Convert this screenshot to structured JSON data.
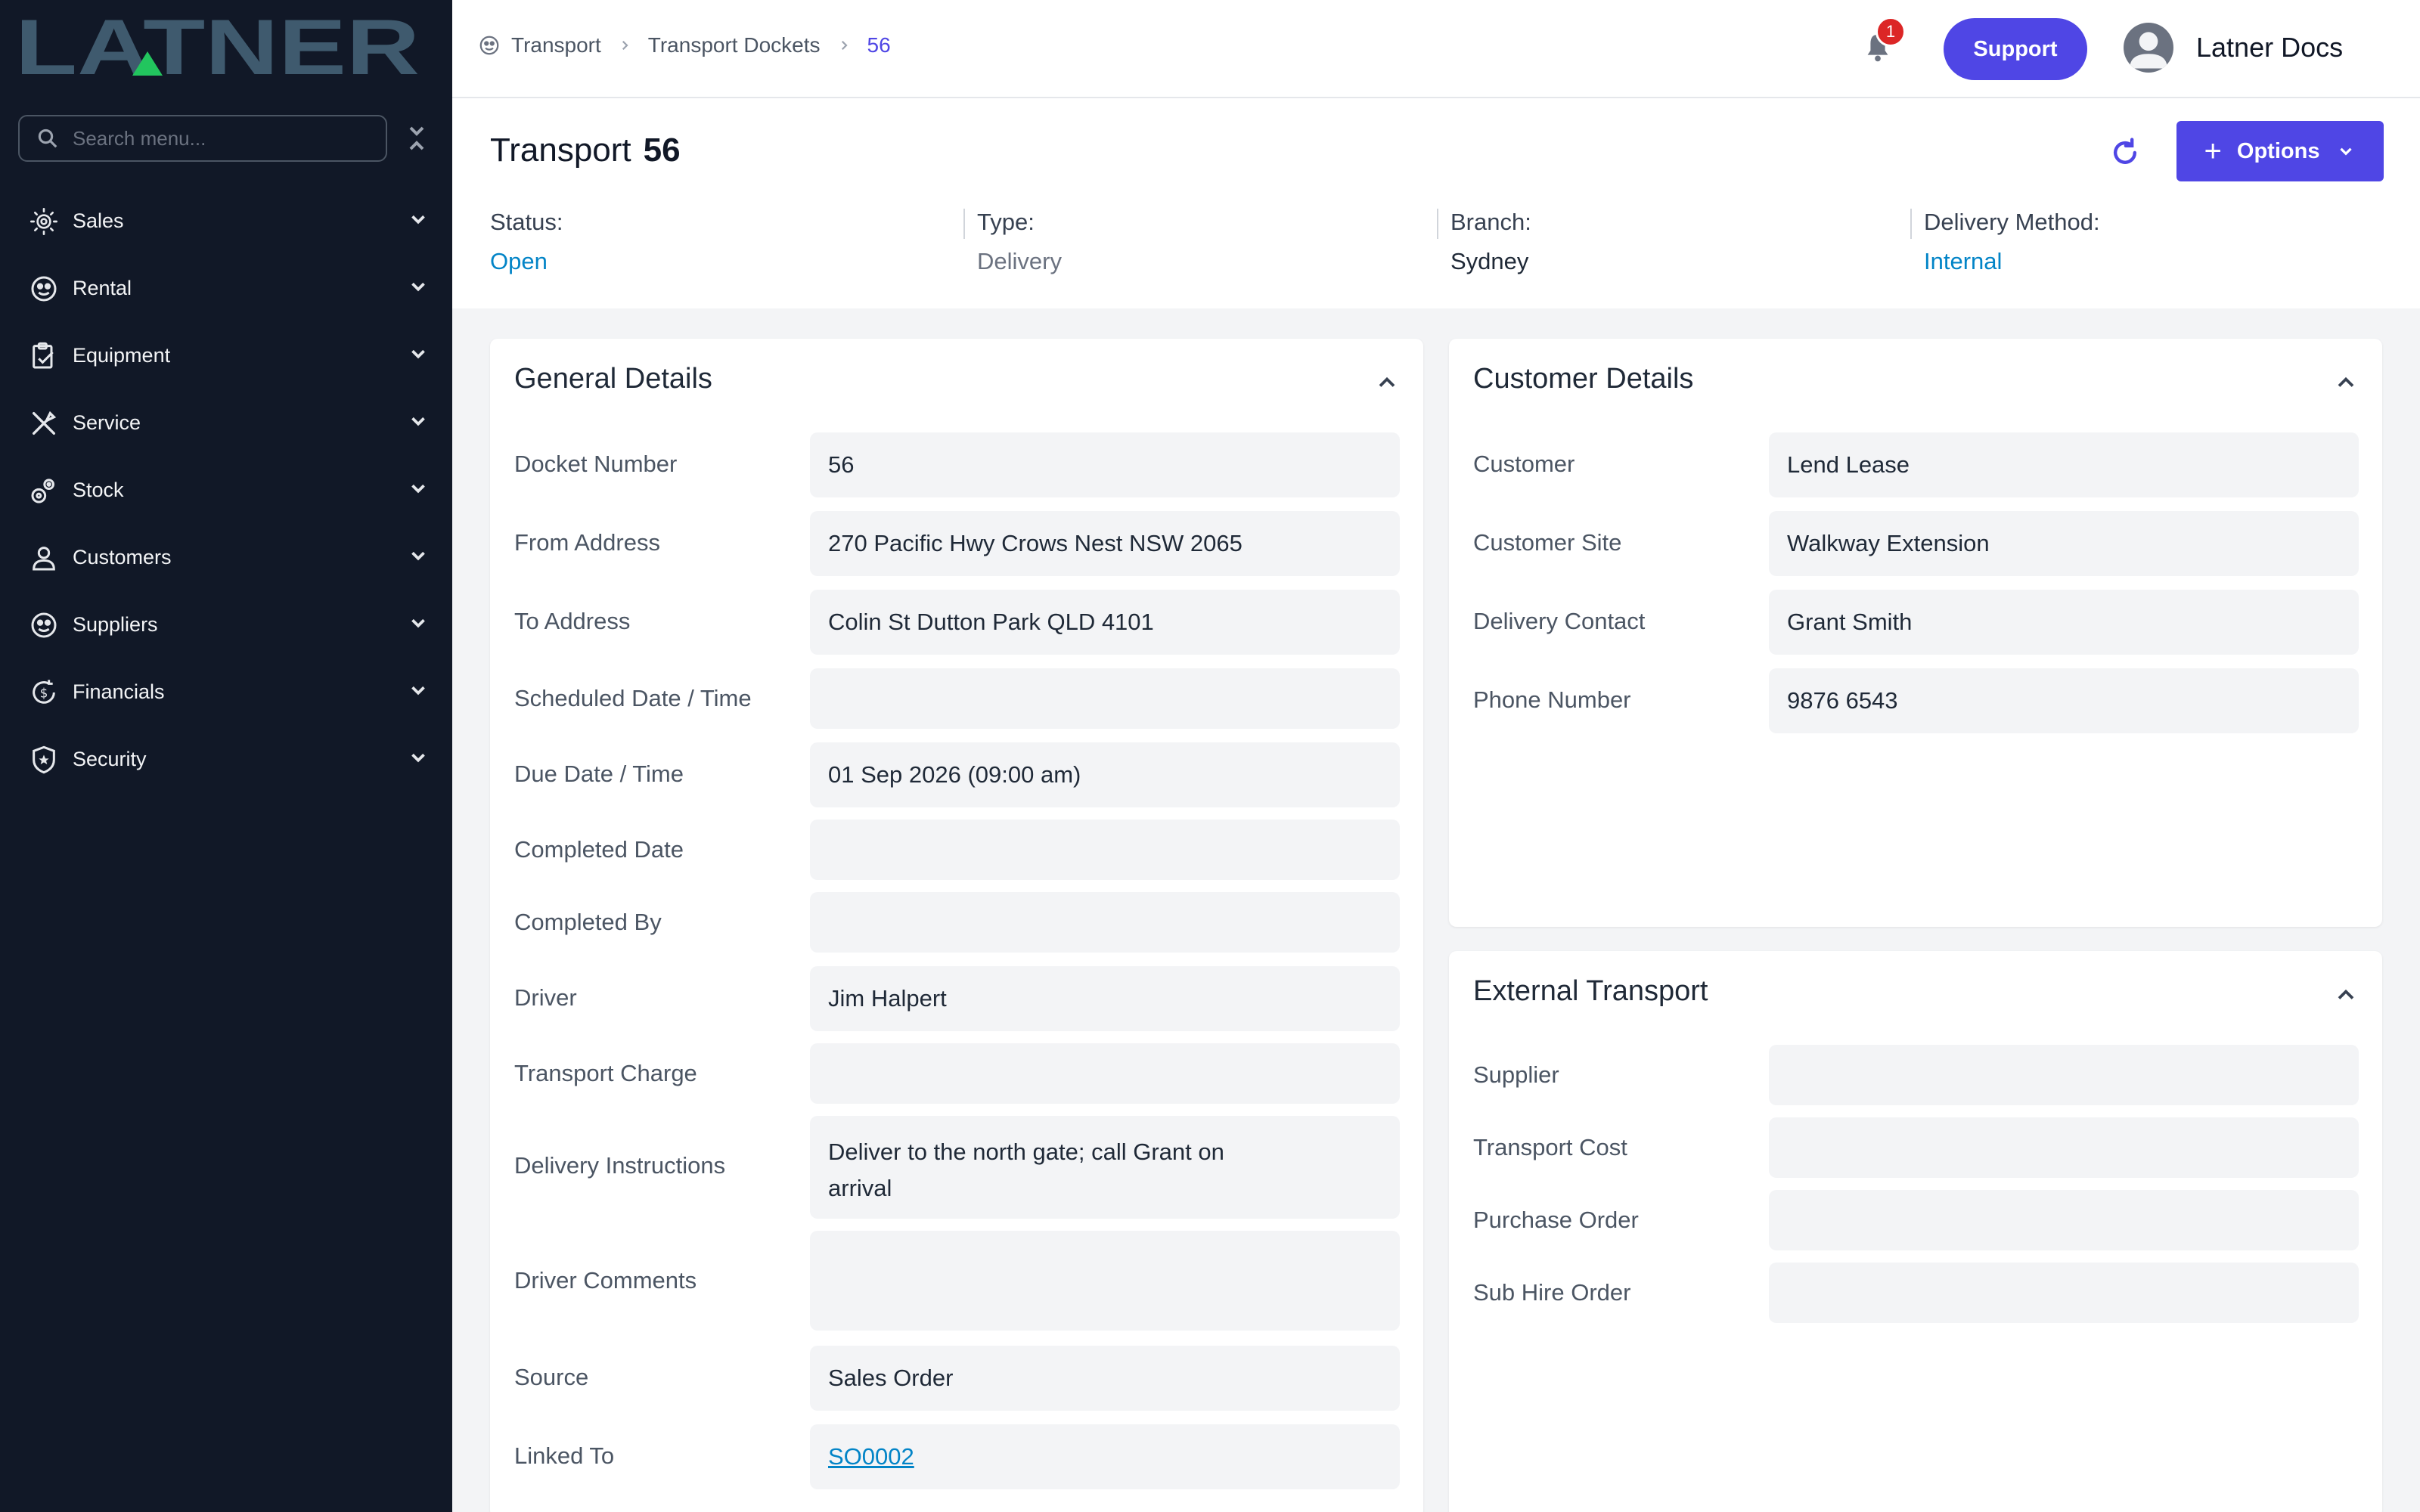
{
  "brand": {
    "logo_text": "LATNER"
  },
  "sidebar": {
    "search_placeholder": "Search menu...",
    "items": [
      {
        "label": "Sales",
        "icon": "sales-icon"
      },
      {
        "label": "Rental",
        "icon": "rental-icon"
      },
      {
        "label": "Equipment",
        "icon": "equipment-icon"
      },
      {
        "label": "Service",
        "icon": "service-icon"
      },
      {
        "label": "Stock",
        "icon": "stock-icon"
      },
      {
        "label": "Customers",
        "icon": "customers-icon"
      },
      {
        "label": "Suppliers",
        "icon": "suppliers-icon"
      },
      {
        "label": "Financials",
        "icon": "financials-icon"
      },
      {
        "label": "Security",
        "icon": "security-icon"
      }
    ]
  },
  "header": {
    "breadcrumb": [
      "Transport",
      "Transport Dockets",
      "56"
    ],
    "notification_count": "1",
    "support_label": "Support",
    "user_name": "Latner Docs"
  },
  "page": {
    "title": "Transport",
    "number": "56",
    "options_label": "Options",
    "meta": [
      {
        "label": "Status:",
        "value": "Open",
        "color": "#0284c7"
      },
      {
        "label": "Type:",
        "value": "Delivery",
        "color": "#6b7280"
      },
      {
        "label": "Branch:",
        "value": "Sydney",
        "color": "#1f2937"
      },
      {
        "label": "Delivery Method:",
        "value": "Internal",
        "color": "#0284c7"
      }
    ]
  },
  "general": {
    "title": "General Details",
    "fields": {
      "docket_number": {
        "label": "Docket Number",
        "value": "56"
      },
      "from_address": {
        "label": "From Address",
        "value": "270 Pacific Hwy Crows Nest NSW 2065"
      },
      "to_address": {
        "label": "To Address",
        "value": "Colin St Dutton Park QLD 4101"
      },
      "scheduled": {
        "label": "Scheduled Date / Time",
        "value": ""
      },
      "due": {
        "label": "Due Date / Time",
        "value": "01 Sep 2026 (09:00 am)"
      },
      "completed_date": {
        "label": "Completed Date",
        "value": ""
      },
      "completed_by": {
        "label": "Completed By",
        "value": ""
      },
      "driver": {
        "label": "Driver",
        "value": "Jim Halpert"
      },
      "transport_charge": {
        "label": "Transport Charge",
        "value": ""
      },
      "delivery_instructions": {
        "label": "Delivery Instructions",
        "value": "Deliver to the north gate; call Grant on arrival"
      },
      "driver_comments": {
        "label": "Driver Comments",
        "value": ""
      },
      "source": {
        "label": "Source",
        "value": "Sales Order"
      },
      "linked_to": {
        "label": "Linked To",
        "value": "SO0002"
      }
    }
  },
  "customer": {
    "title": "Customer Details",
    "fields": {
      "customer": {
        "label": "Customer",
        "value": "Lend Lease"
      },
      "site": {
        "label": "Customer Site",
        "value": "Walkway Extension"
      },
      "contact": {
        "label": "Delivery Contact",
        "value": "Grant Smith"
      },
      "phone": {
        "label": "Phone Number",
        "value": "9876 6543"
      }
    }
  },
  "external": {
    "title": "External Transport",
    "fields": {
      "supplier": {
        "label": "Supplier",
        "value": ""
      },
      "cost": {
        "label": "Transport Cost",
        "value": ""
      },
      "po": {
        "label": "Purchase Order",
        "value": ""
      },
      "sub_hire": {
        "label": "Sub Hire Order",
        "value": ""
      }
    }
  },
  "colors": {
    "sidebar_bg": "#111827",
    "accent": "#4f46e5",
    "link": "#0284c7",
    "logo": "#3f5a6e",
    "logo_accent": "#22c55e",
    "badge": "#dc2626"
  }
}
